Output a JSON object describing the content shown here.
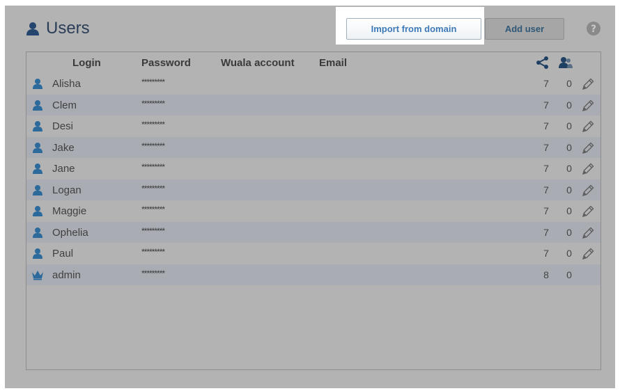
{
  "header": {
    "title": "Users"
  },
  "toolbar": {
    "import_label": "Import from domain",
    "add_label": "Add user"
  },
  "columns": [
    "Login",
    "Password",
    "Wuala account",
    "Email"
  ],
  "rows": [
    {
      "login": "Alisha",
      "password": "*********",
      "count1": "7",
      "count2": "0",
      "icon": "user-icon",
      "editable": true
    },
    {
      "login": "Clem",
      "password": "*********",
      "count1": "7",
      "count2": "0",
      "icon": "user-icon",
      "editable": true
    },
    {
      "login": "Desi",
      "password": "*********",
      "count1": "7",
      "count2": "0",
      "icon": "user-icon",
      "editable": true
    },
    {
      "login": "Jake",
      "password": "*********",
      "count1": "7",
      "count2": "0",
      "icon": "user-icon",
      "editable": true
    },
    {
      "login": "Jane",
      "password": "*********",
      "count1": "7",
      "count2": "0",
      "icon": "user-icon",
      "editable": true
    },
    {
      "login": "Logan",
      "password": "*********",
      "count1": "7",
      "count2": "0",
      "icon": "user-icon",
      "editable": true
    },
    {
      "login": "Maggie",
      "password": "*********",
      "count1": "7",
      "count2": "0",
      "icon": "user-icon",
      "editable": true
    },
    {
      "login": "Ophelia",
      "password": "*********",
      "count1": "7",
      "count2": "0",
      "icon": "user-icon",
      "editable": true
    },
    {
      "login": "Paul",
      "password": "*********",
      "count1": "7",
      "count2": "0",
      "icon": "user-icon",
      "editable": true
    },
    {
      "login": "admin",
      "password": "*********",
      "count1": "8",
      "count2": "0",
      "icon": "crown-icon",
      "editable": false
    }
  ],
  "colors": {
    "accent": "#3d79b9",
    "title": "#2a3e58",
    "icon_blue": "#2d6a9c"
  }
}
